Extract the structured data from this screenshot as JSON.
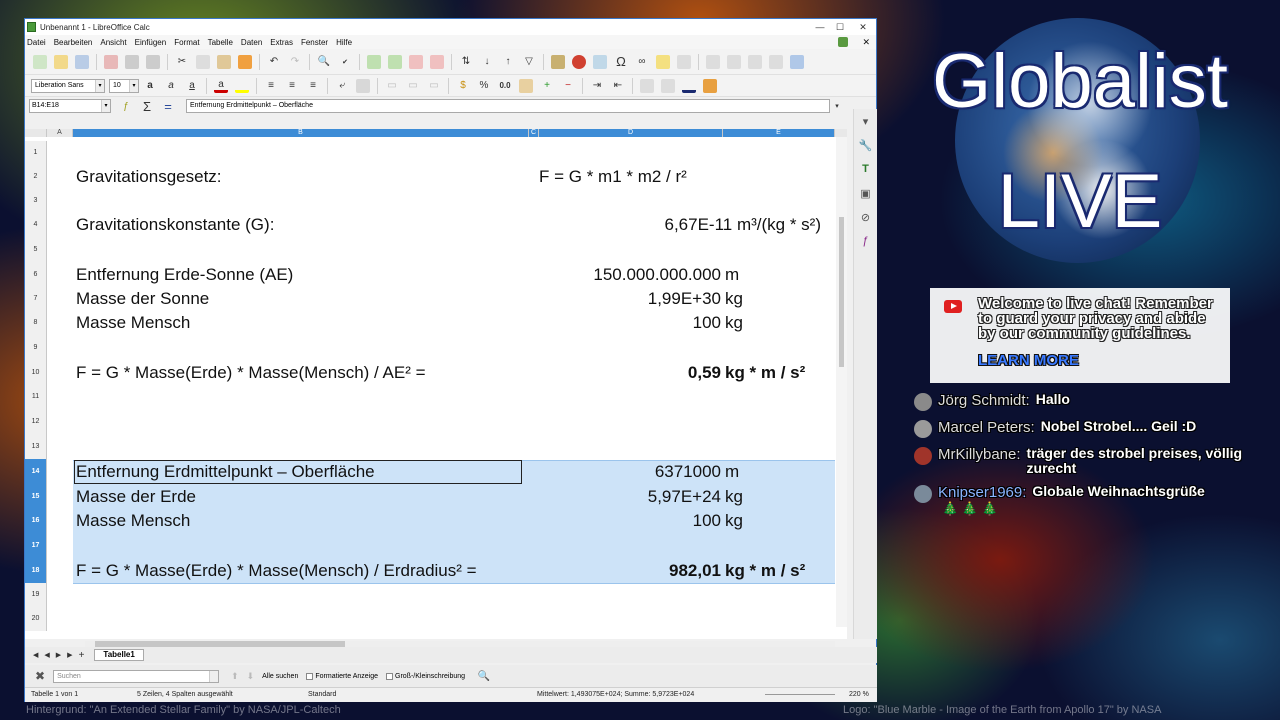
{
  "window": {
    "title": "Unbenannt 1 - LibreOffice Calc",
    "minimize": "—",
    "maximize": "☐",
    "close": "✕"
  },
  "menu": [
    "Datei",
    "Bearbeiten",
    "Ansicht",
    "Einfügen",
    "Format",
    "Tabelle",
    "Daten",
    "Extras",
    "Fenster",
    "Hilfe"
  ],
  "menu_close": "✕",
  "format": {
    "font_name": "Liberation Sans",
    "font_size": "10",
    "percent": "%",
    "decimal": "0.0"
  },
  "formula_bar": {
    "name_box": "B14:E18",
    "content": "Entfernung Erdmittelpunkt – Oberfläche",
    "sum_symbol": "Σ",
    "equals_symbol": "="
  },
  "columns": [
    "A",
    "B",
    "C",
    "D",
    "E"
  ],
  "rows": [
    "1",
    "2",
    "3",
    "4",
    "5",
    "6",
    "7",
    "8",
    "9",
    "10",
    "11",
    "12",
    "13",
    "14",
    "15",
    "16",
    "17",
    "18",
    "19",
    "20"
  ],
  "cells": {
    "r2_label": "Gravitationsgesetz:",
    "r2_formula": "F = G * m1 * m2 / r²",
    "r4_label": "Gravitationskonstante (G):",
    "r4_value": "6,67E-11 m³/(kg * s²)",
    "r6_label": "Entfernung Erde-Sonne (AE)",
    "r6_value": "150.000.000.000",
    "r6_unit": "m",
    "r7_label": "Masse der Sonne",
    "r7_value": "1,99E+30",
    "r7_unit": "kg",
    "r8_label": "Masse Mensch",
    "r8_value": "100",
    "r8_unit": "kg",
    "r10_label": "F = G * Masse(Erde) * Masse(Mensch) / AE² =",
    "r10_value": "0,59",
    "r10_unit": "kg * m / s²",
    "r14_label": "Entfernung Erdmittelpunkt – Oberfläche",
    "r14_value": "6371000",
    "r14_unit": "m",
    "r15_label": "Masse der Erde",
    "r15_value": "5,97E+24",
    "r15_unit": "kg",
    "r16_label": "Masse Mensch",
    "r16_value": "100",
    "r16_unit": "kg",
    "r18_label": "F = G * Masse(Erde) * Masse(Mensch) / Erdradius² =",
    "r18_value": "982,01",
    "r18_unit": "kg * m / s²"
  },
  "sheet_tab": "Tabelle1",
  "find": {
    "placeholder": "Suchen",
    "find_all": "Alle suchen",
    "formatted": "Formatierte Anzeige",
    "match_case": "Groß-/Kleinschreibung"
  },
  "status": {
    "sheet": "Tabelle 1 von 1",
    "selection": "5 Zeilen, 4 Spalten ausgewählt",
    "style": "Standard",
    "summary": "Mittelwert: 1,493075E+024; Summe: 5,9723E+024",
    "zoom": "220 %"
  },
  "overlay": {
    "brand_line1": "Globalist",
    "brand_line2": "LIVE",
    "yt_message": "Welcome to live chat! Remember to guard your privacy and abide by our community guidelines.",
    "yt_learn_more": "LEARN MORE",
    "chat": [
      {
        "author": "Jörg Schmidt:",
        "text": "Hallo",
        "avatar_color": "#8a8a8a"
      },
      {
        "author": "Marcel Peters:",
        "text": "Nobel Strobel.... Geil :D",
        "avatar_color": "#9a9a9a"
      },
      {
        "author": "MrKillybane:",
        "text": "träger des strobel preises, völlig zurecht",
        "avatar_color": "#a0342a"
      },
      {
        "author": "Knipser1969:",
        "text": "Globale Weihnachtsgrüße",
        "avatar_color": "#7a8a9a",
        "member": true
      }
    ],
    "chat_emojis": "🎄 🎄 🎄",
    "credit_left": "Hintergrund: \"An Extended Stellar Family\" by NASA/JPL-Caltech",
    "credit_right": "Logo: \"Blue Marble - Image of the Earth from Apollo 17\" by NASA"
  }
}
